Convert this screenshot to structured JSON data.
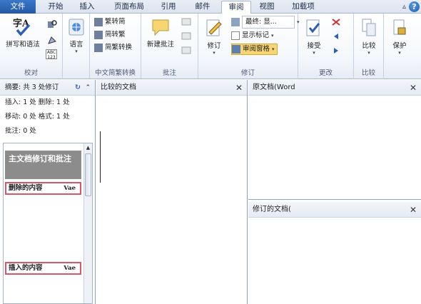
{
  "tabs": [
    "文件",
    "开始",
    "插入",
    "页面布局",
    "引用",
    "邮件",
    "审阅",
    "视图",
    "加载项"
  ],
  "active_tab": "审阅",
  "ribbon": {
    "proofing": {
      "spell_label": "拼写和语法",
      "spell_icon_text": "字A",
      "abc_text": "ABC\n123",
      "group_label": "校对"
    },
    "language": {
      "label": "语言",
      "group_label": ""
    },
    "chinese_conv": {
      "to_simplified": "繁转简",
      "to_traditional": "简转繁",
      "convert": "简繁转换",
      "group_label": "中文简繁转换"
    },
    "comments": {
      "new_comment": "新建批注",
      "group_label": "批注"
    },
    "tracking": {
      "track_changes": "修订",
      "final_display": "最终: 显...",
      "show_markup": "显示标记",
      "reviewing_pane": "审阅窗格",
      "group_label": "修订"
    },
    "changes": {
      "accept": "接受",
      "group_label": "更改"
    },
    "compare": {
      "compare": "比较",
      "group_label": "比较"
    },
    "protect": {
      "protect": "保护"
    }
  },
  "reviewing_pane": {
    "summary": "摘要: 共 3 处修订",
    "stats": [
      "插入: 1 处  删除: 1 处",
      "移动: 0 处  格式: 1 处",
      "批注: 0 处"
    ],
    "main_doc_revisions": "主文档修订和批注",
    "deleted_content": "删除的内容",
    "inserted_content": "插入的内容",
    "user_label": "Vae"
  },
  "panes": {
    "compared": "比较的文档",
    "original": "原文档(Word",
    "revised": "修订的文档("
  },
  "colors": {
    "accent": "#2459a6",
    "revision_border": "#d6586b",
    "highlight": "#f7d572"
  }
}
